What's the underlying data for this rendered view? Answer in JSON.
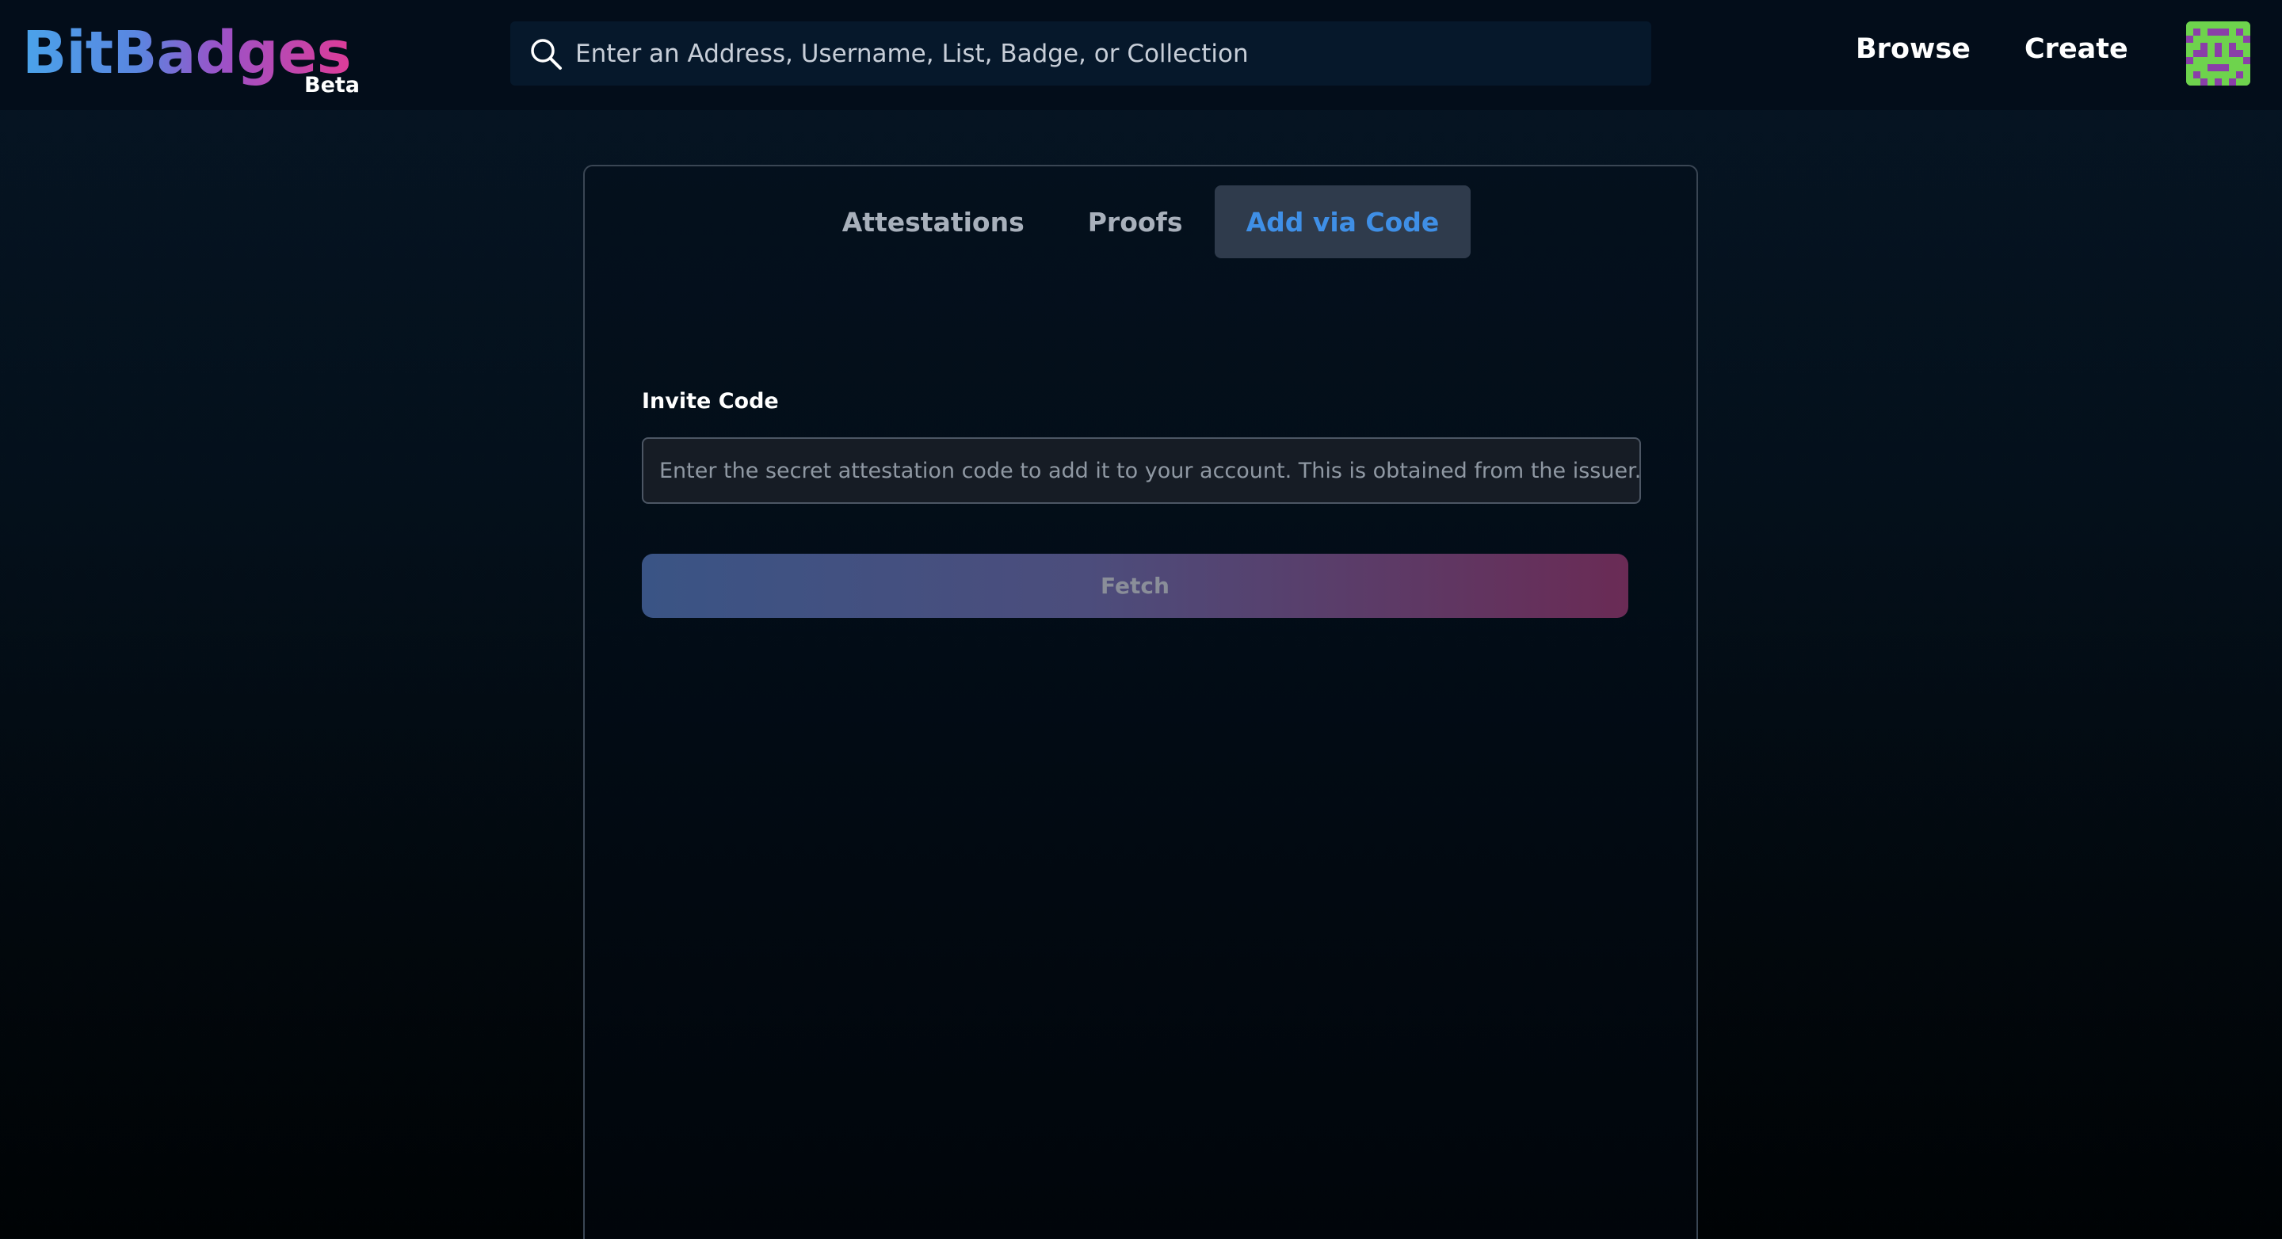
{
  "header": {
    "logo_text": "BitBadges",
    "logo_badge": "Beta",
    "search": {
      "placeholder": "Enter an Address, Username, List, Badge, or Collection"
    },
    "nav": {
      "browse": "Browse",
      "create": "Create"
    },
    "avatar_icon": "identicon-avatar"
  },
  "tabs": [
    {
      "label": "Attestations",
      "active": false
    },
    {
      "label": "Proofs",
      "active": false
    },
    {
      "label": "Add via Code",
      "active": true
    }
  ],
  "form": {
    "invite_code_label": "Invite Code",
    "invite_code_placeholder": "Enter the secret attestation code to add it to your account. This is obtained from the issuer.",
    "fetch_label": "Fetch"
  },
  "colors": {
    "accent_blue": "#3f8fe6",
    "avatar_green": "#6ed34d",
    "avatar_purple": "#8a3fa8"
  }
}
